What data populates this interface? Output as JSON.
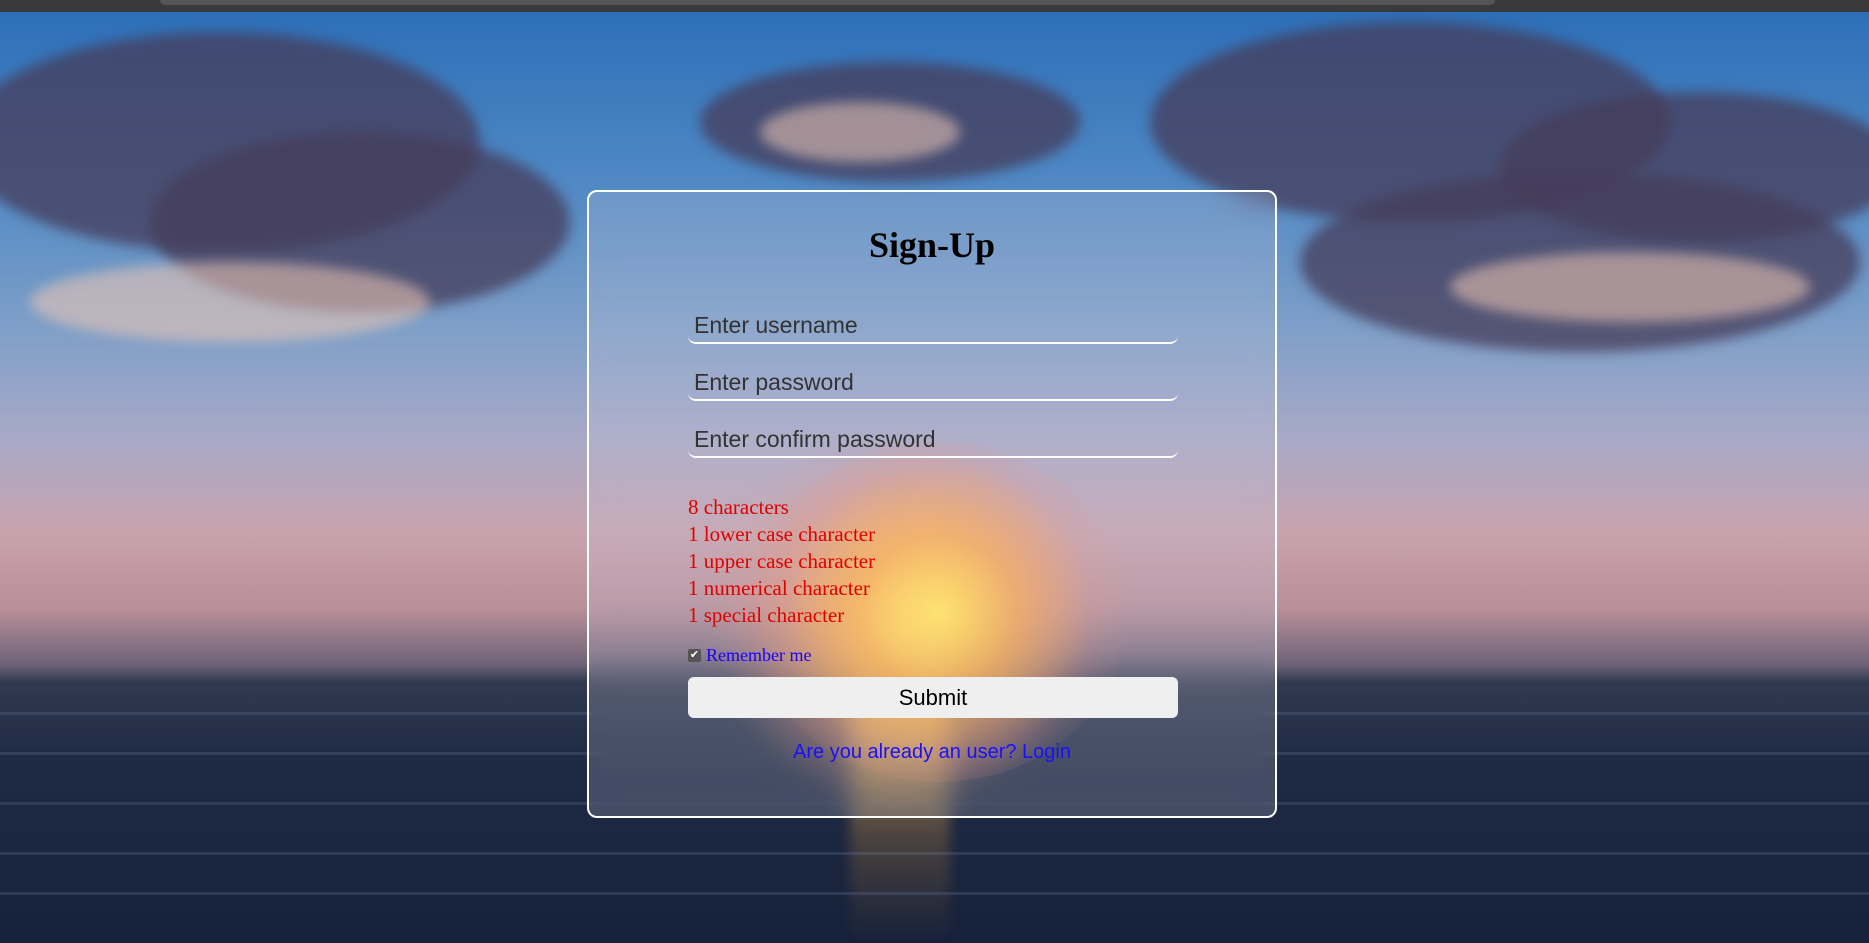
{
  "form": {
    "title": "Sign-Up",
    "username_placeholder": "Enter username",
    "password_placeholder": "Enter password",
    "confirm_placeholder": "Enter confirm password",
    "rules": [
      "8 characters",
      "1 lower case character",
      "1 upper case character",
      "1 numerical character",
      "1 special character"
    ],
    "remember_label": "Remember me",
    "remember_checked": true,
    "submit_label": "Submit",
    "login_link": "Are you already an user? Login"
  },
  "colors": {
    "rule_text": "#e00000",
    "link": "#1a10ff",
    "card_border": "#ffffff"
  }
}
